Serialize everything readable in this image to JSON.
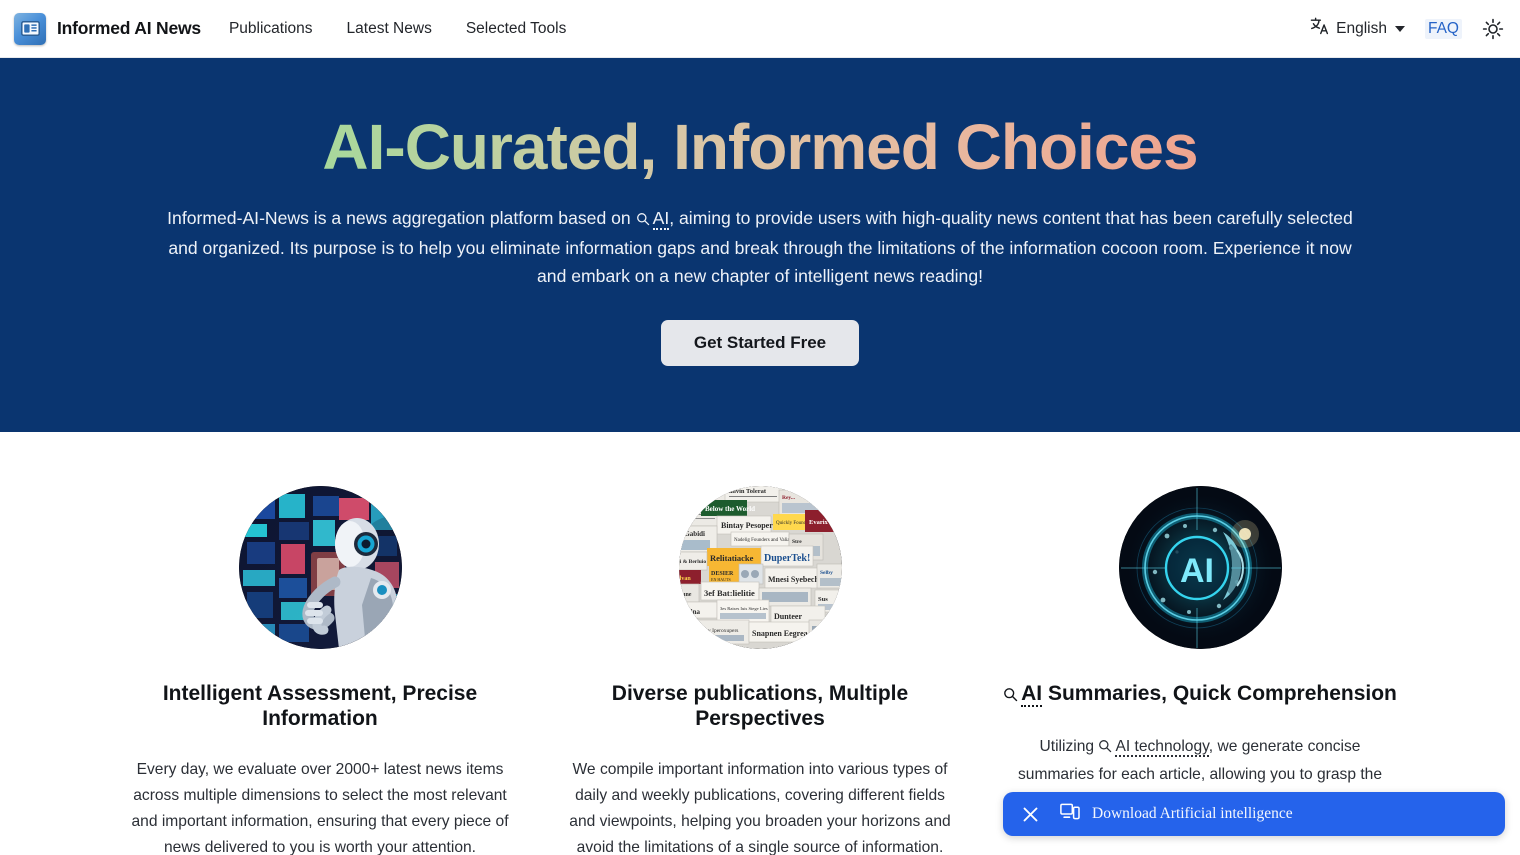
{
  "nav": {
    "brand": "Informed AI News",
    "logo_icon": "newspaper-icon",
    "links": [
      {
        "label": "Publications"
      },
      {
        "label": "Latest News"
      },
      {
        "label": "Selected Tools"
      }
    ],
    "language": {
      "label": "English",
      "icon": "translate-icon",
      "chevron": "chevron-down-icon"
    },
    "faq": "FAQ",
    "theme_toggle": {
      "icon": "sun-icon"
    }
  },
  "hero": {
    "title": "AI-Curated, Informed Choices",
    "title_gradient_from": "#86de97",
    "title_gradient_to": "#f0a08c",
    "background": "#0a3570",
    "paragraph_part1": "Informed-AI-News is a news aggregation platform based on ",
    "ai_term": "AI",
    "ai_icon": "search-icon",
    "paragraph_part2": ", aiming to provide users with high-quality news content that has been carefully selected and organized. Its purpose is to help you eliminate information gaps and break through the limitations of the information cocoon room. Experience it now and embark on a new chapter of intelligent news reading!",
    "cta_label": "Get Started Free"
  },
  "features": [
    {
      "image_alt": "humanoid-robot-at-holographic-news-wall",
      "title": "Intelligent Assessment, Precise Information",
      "text": "Every day, we evaluate over 2000+ latest news items across multiple dimensions to select the most relevant and important information, ensuring that every piece of news delivered to you is worth your attention."
    },
    {
      "image_alt": "collage-of-newspapers",
      "title": "Diverse publications, Multiple Perspectives",
      "text": "We compile important information into various types of daily and weekly publications, covering different fields and viewpoints, helping you broaden your horizons and avoid the limitations of a single source of information."
    },
    {
      "image_alt": "glowing-ai-orb-with-face-profile",
      "title_ai_term": "AI",
      "title_rest": " Summaries, Quick Comprehension",
      "text_part1": "Utilizing ",
      "text_ai_term": "AI technology",
      "text_part2": ", we generate concise summaries for each article, allowing you to grasp the"
    }
  ],
  "toast": {
    "label": "Download Artificial intelligence",
    "close_icon": "close-icon",
    "cast_icon": "device-cast-icon",
    "background": "#2563eb"
  }
}
